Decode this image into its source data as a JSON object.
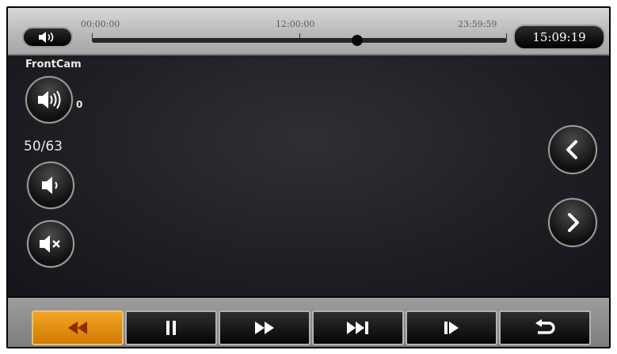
{
  "timeline": {
    "start": "00:00:00",
    "middle": "12:00:00",
    "end": "23:59:59",
    "position": 0.64
  },
  "clock": "15:09:19",
  "camera": {
    "name": "FrontCam",
    "volume": "0",
    "file_counter": "50/63"
  },
  "icons": {
    "top_sound": "speaker-icon",
    "volume_up": "volume-up-icon",
    "volume_down": "volume-down-icon",
    "mute": "mute-icon",
    "previous": "chevron-left-icon",
    "next": "chevron-right-icon",
    "rewind": "rewind-icon",
    "pause": "pause-icon",
    "fast_forward": "fast-forward-icon",
    "skip_next": "skip-next-icon",
    "frame_step": "frame-step-icon",
    "back": "return-icon"
  },
  "colors": {
    "active_button": "#f2a423",
    "active_icon": "#8a2c00",
    "inactive_icon": "#ffffff"
  }
}
